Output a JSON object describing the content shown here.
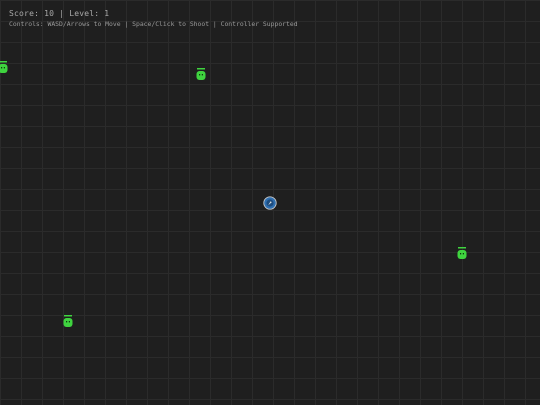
{
  "hud": {
    "score_level": "Score: 10 | Level: 1",
    "controls": "Controls: WASD/Arrows to Move | Space/Click to Shoot | Controller Supported"
  },
  "colors": {
    "background": "#1f1f1f",
    "grid": "#2b2b2b",
    "enemy": "#3fd43f",
    "enemy_health": "#3fd43f",
    "player_body": "#2f6fb0",
    "player_ring": "#c9c9c9"
  },
  "entities": {
    "player": {
      "icon": "player-ship-icon"
    },
    "enemies": [
      {
        "icon": "enemy-slime-icon"
      },
      {
        "icon": "enemy-slime-icon"
      },
      {
        "icon": "enemy-slime-icon"
      },
      {
        "icon": "enemy-slime-icon"
      }
    ]
  }
}
